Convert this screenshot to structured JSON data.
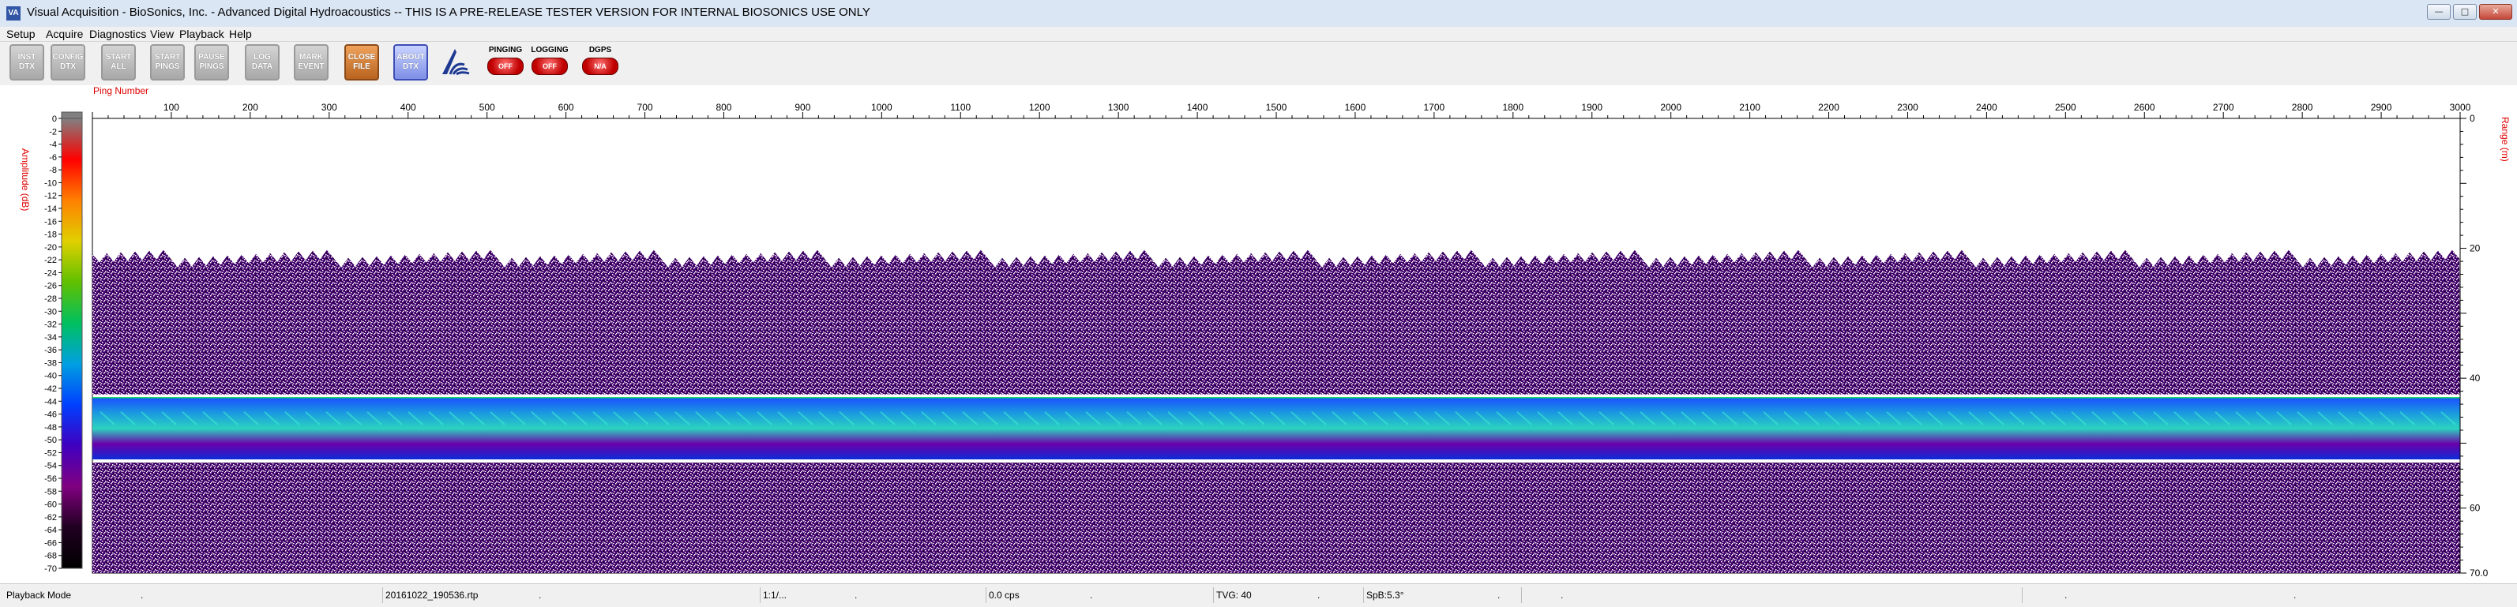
{
  "window": {
    "title": "Visual Acquisition  -  BioSonics, Inc.  -  Advanced Digital Hydroacoustics  --  THIS IS A PRE-RELEASE TESTER VERSION FOR INTERNAL BIOSONICS USE ONLY",
    "icon_name": "visual-acquisition-app-icon",
    "app_icon_text": "VA"
  },
  "menu": [
    {
      "label": "Setup"
    },
    {
      "label": "Acquire"
    },
    {
      "label": "Diagnostics"
    },
    {
      "label": "View"
    },
    {
      "label": "Playback"
    },
    {
      "label": "Help"
    }
  ],
  "toolbar": {
    "buttons": [
      {
        "name": "inst-dtx-button",
        "line1": "INST",
        "line2": "DTX",
        "style": "gray"
      },
      {
        "name": "config-dtx-button",
        "line1": "CONFIG",
        "line2": "DTX",
        "style": "gray"
      },
      {
        "name": "start-all-button",
        "line1": "START",
        "line2": "ALL",
        "style": "gray"
      },
      {
        "name": "start-pings-button",
        "line1": "START",
        "line2": "PINGS",
        "style": "gray"
      },
      {
        "name": "pause-pings-button",
        "line1": "PAUSE",
        "line2": "PINGS",
        "style": "gray"
      },
      {
        "name": "log-data-button",
        "line1": "LOG",
        "line2": "DATA",
        "style": "gray"
      },
      {
        "name": "mark-event-button",
        "line1": "MARK",
        "line2": "EVENT",
        "style": "gray"
      },
      {
        "name": "close-file-button",
        "line1": "CLOSE",
        "line2": "FILE",
        "style": "orange"
      },
      {
        "name": "about-dtx-button",
        "line1": "ABOUT",
        "line2": "DTX",
        "style": "blue"
      }
    ],
    "logo_icon": "biosonics-logo-icon",
    "indicators": [
      {
        "name": "pinging-indicator",
        "label": "PINGING",
        "state": "OFF"
      },
      {
        "name": "logging-indicator",
        "label": "LOGGING",
        "state": "OFF"
      },
      {
        "name": "dgps-indicator",
        "label": "DGPS",
        "state": "N/A"
      }
    ]
  },
  "plot": {
    "x_title": "Ping Number",
    "left_title": "Amplitude (dB)",
    "right_title": "Range (m)",
    "x_ticks": [
      100,
      200,
      300,
      400,
      500,
      600,
      700,
      800,
      900,
      1000,
      1100,
      1200,
      1300,
      1400,
      1500,
      1600,
      1700,
      1800,
      1900,
      2000,
      2100,
      2200,
      2300,
      2400,
      2500,
      2600,
      2700,
      2800,
      2900,
      3000
    ],
    "x_range": [
      0,
      3000
    ],
    "range_ticks": [
      "0",
      "20",
      "40",
      "60",
      "70.0"
    ],
    "range_tick_values": [
      0,
      20,
      40,
      60,
      70
    ],
    "range_max": 70,
    "amp_ticks": [
      0,
      -2,
      -4,
      -6,
      -8,
      -10,
      -12,
      -14,
      -16,
      -18,
      -20,
      -22,
      -24,
      -26,
      -28,
      -30,
      -32,
      -34,
      -36,
      -38,
      -40,
      -42,
      -44,
      -46,
      -48,
      -50,
      -52,
      -54,
      -56,
      -58,
      -60,
      -62,
      -64,
      -66,
      -68,
      -70
    ],
    "amp_range": [
      0,
      -70
    ],
    "colorbar": [
      "#808080",
      "#ff0000",
      "#ff8000",
      "#e0d000",
      "#60c000",
      "#00c060",
      "#00a0e0",
      "#0040ff",
      "#4000c0",
      "#800080",
      "#200020",
      "#000000"
    ],
    "echogram": {
      "noise_top_m": 20,
      "noise_bottom_m": 42.5,
      "layer_top_m": 43,
      "layer_bottom_m": 52.5,
      "below_top_m": 53,
      "below_bottom_m": 70,
      "noise_color": "#40006a",
      "layer_colors": [
        "#1a4fff",
        "#1b9ae0",
        "#2bd3c0",
        "#6a00aa",
        "#0d2bd8"
      ]
    },
    "accent_red": "#e00000"
  },
  "status": [
    {
      "name": "status-mode",
      "text": "Playback Mode"
    },
    {
      "name": "status-dot1",
      "text": "."
    },
    {
      "name": "status-file",
      "text": "20161022_190536.rtp"
    },
    {
      "name": "status-dot2",
      "text": "."
    },
    {
      "name": "status-ratio",
      "text": "1:1/..."
    },
    {
      "name": "status-dot3",
      "text": "."
    },
    {
      "name": "status-cps",
      "text": "0.0 cps"
    },
    {
      "name": "status-dot4",
      "text": "."
    },
    {
      "name": "status-tvg",
      "text": "TVG: 40"
    },
    {
      "name": "status-dot5",
      "text": "."
    },
    {
      "name": "status-spb",
      "text": "SpB:5.3°"
    },
    {
      "name": "status-dot6",
      "text": "."
    },
    {
      "name": "status-dot7",
      "text": "."
    },
    {
      "name": "status-dot8",
      "text": "."
    },
    {
      "name": "status-dot9",
      "text": "."
    }
  ]
}
